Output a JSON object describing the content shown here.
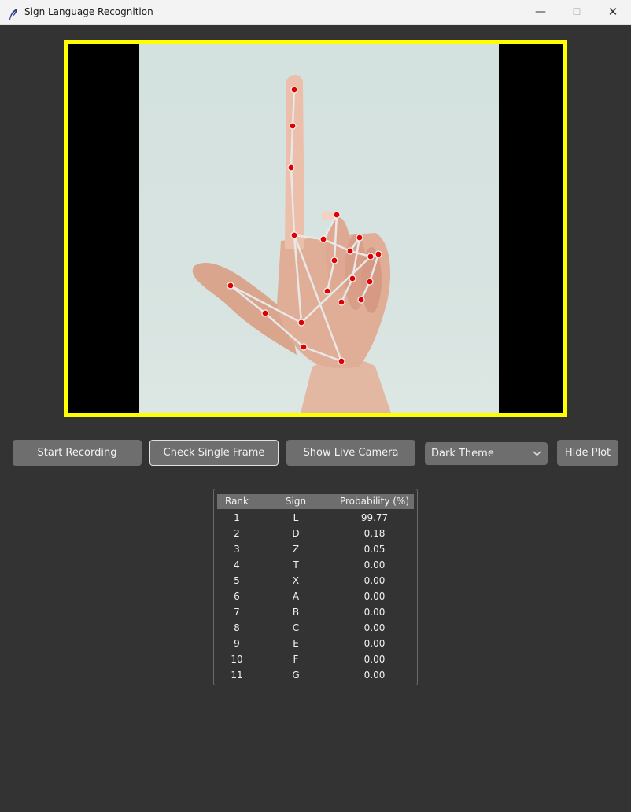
{
  "window": {
    "title": "Sign Language Recognition",
    "minimize": "—",
    "maximize": "☐",
    "close": "✕"
  },
  "controls": {
    "start_recording": "Start Recording",
    "check_single_frame": "Check Single Frame",
    "show_live_camera": "Show Live Camera",
    "theme_selected": "Dark Theme",
    "hide_plot": "Hide Plot"
  },
  "table": {
    "headers": [
      "Rank",
      "Sign",
      "Probability (%)"
    ],
    "rows": [
      [
        "1",
        "L",
        "99.77"
      ],
      [
        "2",
        "D",
        "0.18"
      ],
      [
        "3",
        "Z",
        "0.05"
      ],
      [
        "4",
        "T",
        "0.00"
      ],
      [
        "5",
        "X",
        "0.00"
      ],
      [
        "6",
        "A",
        "0.00"
      ],
      [
        "7",
        "B",
        "0.00"
      ],
      [
        "8",
        "C",
        "0.00"
      ],
      [
        "9",
        "E",
        "0.00"
      ],
      [
        "10",
        "F",
        "0.00"
      ],
      [
        "11",
        "G",
        "0.00"
      ]
    ]
  },
  "colors": {
    "frame_border": "#ffff00",
    "landmark": "#e00000",
    "connection": "#e8e8e8",
    "background": "#333333"
  }
}
